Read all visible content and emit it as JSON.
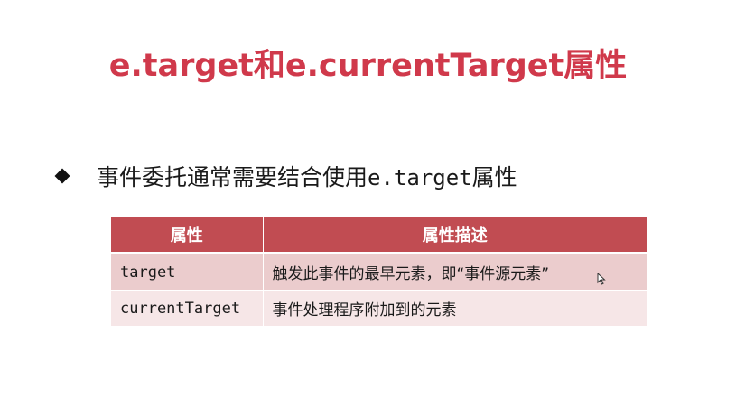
{
  "slide": {
    "title": "e.target和e.currentTarget属性",
    "bullet": {
      "icon": "diamond-bullet-icon",
      "text_before": "事件委托通常需要结合使用",
      "code": "e.target",
      "text_after": "属性"
    },
    "table": {
      "headers": [
        "属性",
        "属性描述"
      ],
      "rows": [
        {
          "name": "target",
          "description": "触发此事件的最早元素，即“事件源元素”"
        },
        {
          "name": "currentTarget",
          "description": "事件处理程序附加到的元素"
        }
      ]
    }
  },
  "colors": {
    "title": "#d0394b",
    "header_bg": "#c14c52",
    "row1_bg": "#ebcccd",
    "row2_bg": "#f6e6e7"
  }
}
